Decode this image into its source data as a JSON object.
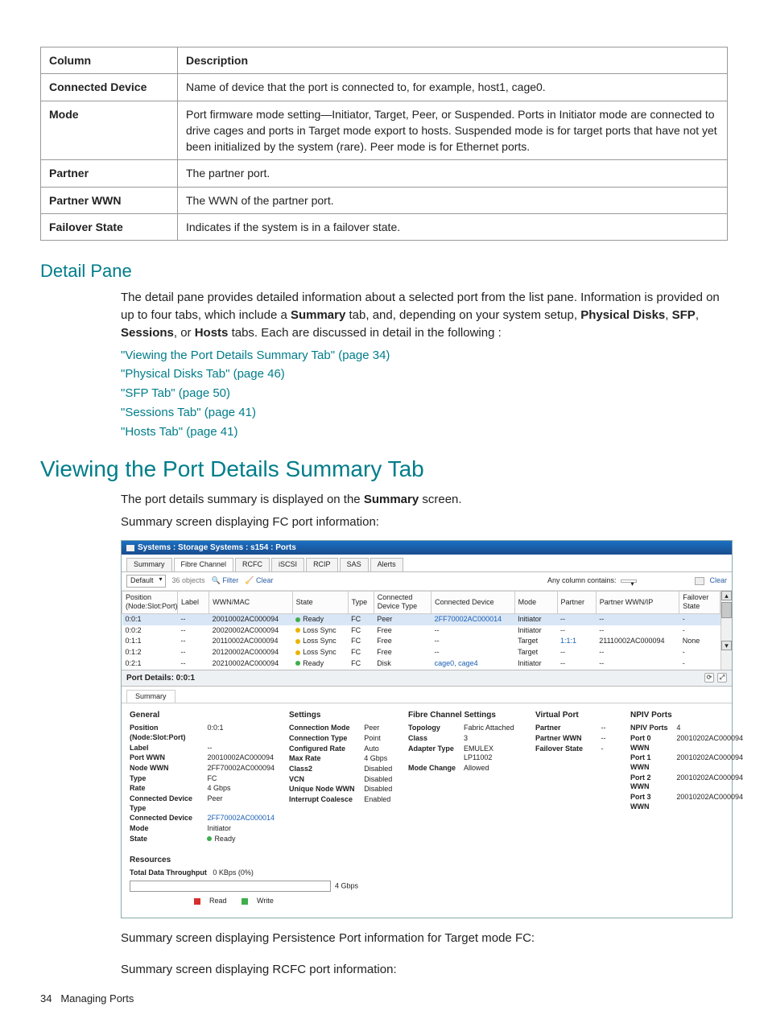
{
  "table": {
    "headers": [
      "Column",
      "Description"
    ],
    "rows": [
      {
        "col": "Connected Device",
        "desc": "Name of device that the port is connected to, for example, host1, cage0."
      },
      {
        "col": "Mode",
        "desc": "Port firmware mode setting—Initiator, Target, Peer, or Suspended. Ports in Initiator mode are connected to drive cages and ports in Target mode export to hosts. Suspended mode is for target ports that have not yet been initialized by the system (rare). Peer mode is for Ethernet ports."
      },
      {
        "col": "Partner",
        "desc": "The partner port."
      },
      {
        "col": "Partner WWN",
        "desc": "The WWN of the partner port."
      },
      {
        "col": "Failover State",
        "desc": "Indicates if the system is in a failover state."
      }
    ]
  },
  "detail_pane": {
    "heading": "Detail Pane",
    "para_parts": [
      "The detail pane provides detailed information about a selected port from the list pane. Information is provided on up to four tabs, which include a ",
      "Summary",
      " tab, and, depending on your system setup, ",
      "Physical Disks",
      ", ",
      "SFP",
      ", ",
      "Sessions",
      ", or ",
      "Hosts",
      " tabs. Each are discussed in detail in the following :"
    ],
    "links": [
      "\"Viewing the Port Details Summary Tab\" (page 34)",
      "\"Physical Disks Tab\" (page 46)",
      "\"SFP Tab\" (page 50)",
      "\"Sessions Tab\" (page 41)",
      "\"Hosts Tab\" (page 41)"
    ]
  },
  "viewing": {
    "heading": "Viewing the Port Details Summary Tab",
    "para_parts": [
      "The port details summary is displayed on the ",
      "Summary",
      " screen."
    ],
    "subcaption": "Summary screen displaying FC port information:",
    "after_img1": "Summary screen displaying Persistence Port information for Target mode FC:",
    "after_img2": "Summary screen displaying RCFC port information:"
  },
  "mock": {
    "title": "Systems : Storage Systems : s154 : Ports",
    "tabs": [
      "Summary",
      "Fibre Channel",
      "RCFC",
      "iSCSI",
      "RCIP",
      "SAS",
      "Alerts"
    ],
    "active_tab": 1,
    "filter": {
      "default": "Default",
      "count": "36 objects",
      "filter_icon_label": "Filter",
      "clear": "Clear",
      "anycol": "Any column contains:",
      "right_clear": "Clear"
    },
    "list": {
      "headers": [
        "Position (Node:Slot:Port)",
        "Label",
        "WWN/MAC",
        "State",
        "Type",
        "Connected Device Type",
        "Connected Device",
        "Mode",
        "Partner",
        "Partner WWN/IP",
        "Failover State"
      ],
      "rows": [
        {
          "pos": "0:0:1",
          "label": "--",
          "wwn": "20010002AC000094",
          "state": "Ready",
          "dot": "g",
          "type": "FC",
          "cdt": "Peer",
          "cd": "2FF70002AC000014",
          "mode": "Initiator",
          "partner": "--",
          "pwwn": "--",
          "fail": "-",
          "sel": true
        },
        {
          "pos": "0:0:2",
          "label": "--",
          "wwn": "20020002AC000094",
          "state": "Loss Sync",
          "dot": "y",
          "type": "FC",
          "cdt": "Free",
          "cd": "--",
          "mode": "Initiator",
          "partner": "--",
          "pwwn": "--",
          "fail": "-"
        },
        {
          "pos": "0:1:1",
          "label": "--",
          "wwn": "20110002AC000094",
          "state": "Loss Sync",
          "dot": "y",
          "type": "FC",
          "cdt": "Free",
          "cd": "--",
          "mode": "Target",
          "partner": "1:1:1",
          "pwwn": "21110002AC000094",
          "fail": "None"
        },
        {
          "pos": "0:1:2",
          "label": "--",
          "wwn": "20120002AC000094",
          "state": "Loss Sync",
          "dot": "y",
          "type": "FC",
          "cdt": "Free",
          "cd": "--",
          "mode": "Target",
          "partner": "--",
          "pwwn": "--",
          "fail": "-"
        },
        {
          "pos": "0:2:1",
          "label": "--",
          "wwn": "20210002AC000094",
          "state": "Ready",
          "dot": "g",
          "type": "FC",
          "cdt": "Disk",
          "cd": "cage0, cage4",
          "mode": "Initiator",
          "partner": "--",
          "pwwn": "--",
          "fail": "-"
        }
      ]
    },
    "details_title": "Port Details: 0:0:1",
    "details_tab": "Summary",
    "general": {
      "title": "General",
      "rows": [
        [
          "Position (Node:Slot:Port)",
          "0:0:1"
        ],
        [
          "Label",
          "--"
        ],
        [
          "Port WWN",
          "20010002AC000094"
        ],
        [
          "Node WWN",
          "2FF70002AC000094"
        ],
        [
          "Type",
          "FC"
        ],
        [
          "Rate",
          "4 Gbps"
        ],
        [
          "Connected Device Type",
          "Peer"
        ],
        [
          "Connected Device",
          "2FF70002AC000014"
        ],
        [
          "Mode",
          "Initiator"
        ],
        [
          "State",
          "Ready"
        ]
      ],
      "state_dot": "g",
      "connected_device_is_link": true
    },
    "settings": {
      "title": "Settings",
      "rows": [
        [
          "Connection Mode",
          "Peer"
        ],
        [
          "Connection Type",
          "Point"
        ],
        [
          "Configured Rate",
          "Auto"
        ],
        [
          "Max Rate",
          "4 Gbps"
        ],
        [
          "Class2",
          "Disabled"
        ],
        [
          "VCN",
          "Disabled"
        ],
        [
          "Unique Node WWN",
          "Disabled"
        ],
        [
          "Interrupt Coalesce",
          "Enabled"
        ]
      ]
    },
    "fcs": {
      "title": "Fibre Channel Settings",
      "rows": [
        [
          "Topology",
          "Fabric Attached"
        ],
        [
          "Class",
          "3"
        ],
        [
          "Adapter Type",
          "EMULEX LP11002"
        ],
        [
          "Mode Change",
          "Allowed"
        ]
      ]
    },
    "vport": {
      "title": "Virtual Port",
      "rows": [
        [
          "Partner",
          "--"
        ],
        [
          "Partner WWN",
          "--"
        ],
        [
          "Failover State",
          "-"
        ]
      ]
    },
    "npiv": {
      "title": "NPIV Ports",
      "rows": [
        [
          "NPIV Ports",
          "4"
        ],
        [
          "Port 0 WWN",
          "20010202AC000094"
        ],
        [
          "Port 1 WWN",
          "20010202AC000094"
        ],
        [
          "Port 2 WWN",
          "20010202AC000094"
        ],
        [
          "Port 3 WWN",
          "20010202AC000094"
        ]
      ]
    },
    "resources": {
      "title": "Resources",
      "label": "Total Data Throughput",
      "value": "0 KBps (0%)",
      "scale": "4 Gbps",
      "read": "Read",
      "write": "Write"
    }
  },
  "footer": {
    "page": "34",
    "label": "Managing Ports"
  }
}
